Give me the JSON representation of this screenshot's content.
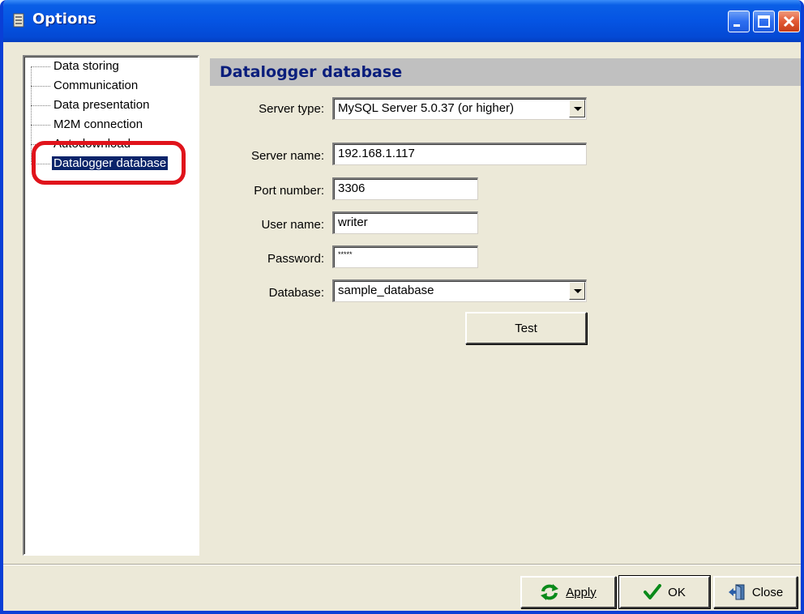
{
  "window": {
    "title": "Options"
  },
  "tree": {
    "items": [
      {
        "label": "Data storing"
      },
      {
        "label": "Communication"
      },
      {
        "label": "Data presentation"
      },
      {
        "label": "M2M connection"
      },
      {
        "label": "Autodownload"
      },
      {
        "label": "Datalogger database",
        "selected": true
      }
    ]
  },
  "panel": {
    "header": "Datalogger database",
    "server_type": {
      "label": "Server type:",
      "value": "MySQL Server 5.0.37 (or higher)"
    },
    "server_name": {
      "label": "Server name:",
      "value": "192.168.1.117"
    },
    "port_number": {
      "label": "Port number:",
      "value": "3306"
    },
    "user_name": {
      "label": "User name:",
      "value": "writer"
    },
    "password": {
      "label": "Password:",
      "value": "*****"
    },
    "database": {
      "label": "Database:",
      "value": "sample_database"
    },
    "test_label": "Test"
  },
  "footer": {
    "apply_label": "Apply",
    "ok_label": "OK",
    "close_label": "Close"
  },
  "colors": {
    "titlebar": "#0554e3",
    "selection": "#0a246a",
    "highlight_ring": "#e0131b",
    "header_text": "#0a1e7c"
  }
}
